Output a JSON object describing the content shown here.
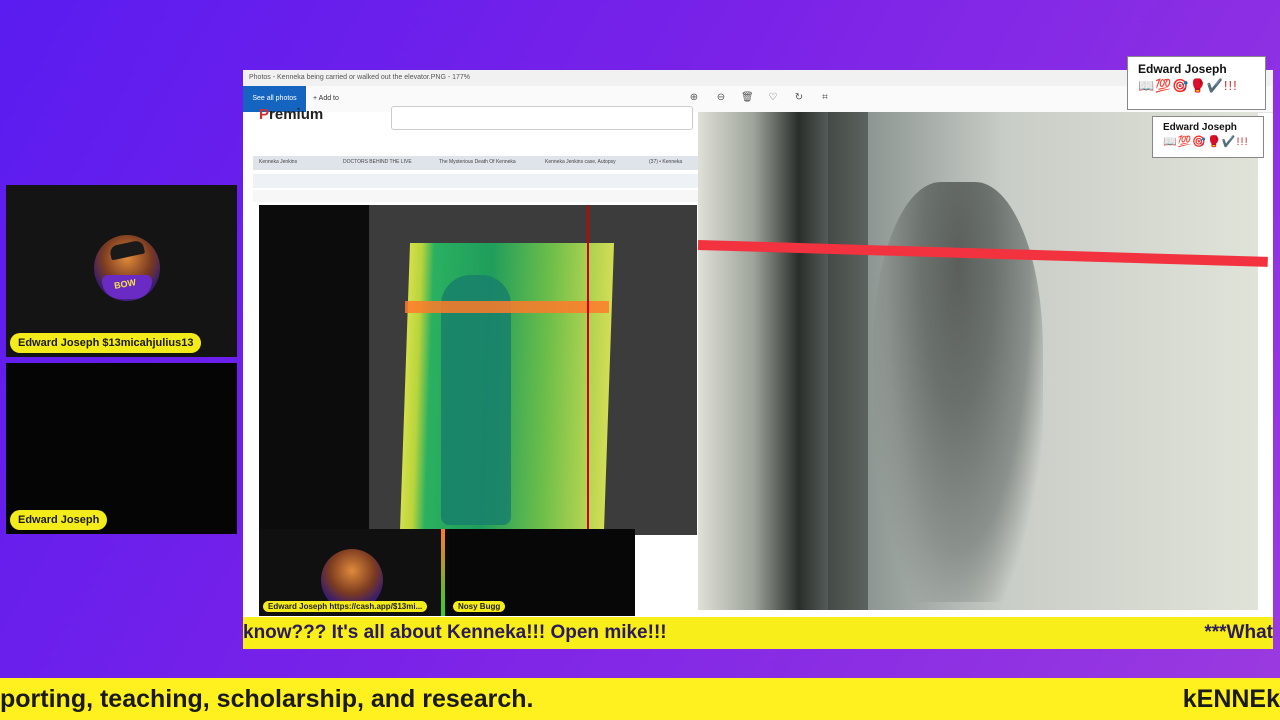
{
  "participants": [
    {
      "name": "Edward Joseph $13micahjulius13"
    },
    {
      "name": "Edward Joseph"
    }
  ],
  "screen": {
    "titlebar": "Photos - Kenneka being carried or walked out the elevator.PNG - 177%",
    "see_all_label": "See all photos",
    "add_label": "+ Add to",
    "premium_text": "Premium",
    "browser_tabs": [
      "Kenneka Jenkins",
      "DOCTORS BEHIND THE LIVE",
      "The Mysterious Death Of Kenneka",
      "Kenneka Jenkins case, Autopsy",
      "(37) • Kenneka"
    ],
    "mini_participants": [
      {
        "name": "Edward Joseph https://cash.app/$13mi..."
      },
      {
        "name": "Nosy Bugg"
      }
    ]
  },
  "name_overlays": [
    {
      "name": "Edward Joseph",
      "emojis": "📖💯🎯🥊✔️!!!"
    },
    {
      "name": "Edward Joseph",
      "emojis": "📖💯🎯🥊✔️!!!"
    }
  ],
  "ticker_inner": {
    "text": "know??? It's all about Kenneka!!! Open mike!!!",
    "tail": "***What"
  },
  "ticker_outer": {
    "text": "porting, teaching, scholarship, and research.",
    "tail": "kENNEk"
  },
  "colors": {
    "ticker_yellow": "#f7ee1a",
    "pill_yellow": "#f4ec1a",
    "background": "#6a22ea"
  }
}
